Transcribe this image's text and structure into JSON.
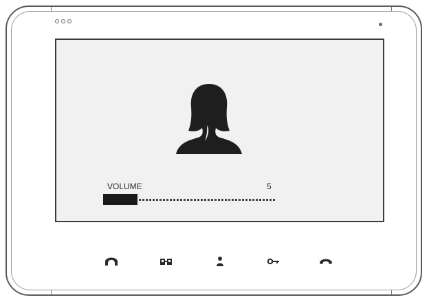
{
  "screen": {
    "volume_label": "VOLUME",
    "volume_value": "5",
    "volume_max": 10
  },
  "buttons": [
    {
      "name": "answer-button",
      "icon": "answer-handset-icon"
    },
    {
      "name": "monitor-button",
      "icon": "monitor-icon"
    },
    {
      "name": "intercom-button",
      "icon": "person-icon"
    },
    {
      "name": "unlock-button",
      "icon": "key-icon"
    },
    {
      "name": "hangup-button",
      "icon": "hangup-handset-icon"
    }
  ]
}
